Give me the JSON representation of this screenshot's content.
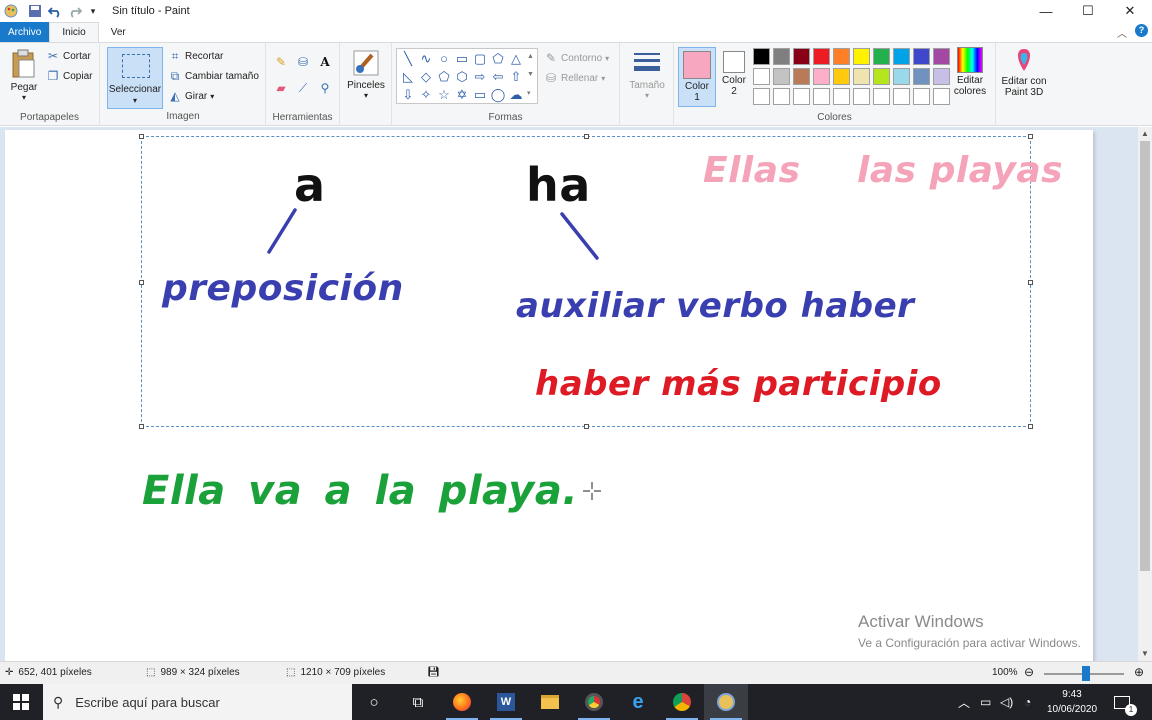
{
  "window": {
    "title": "Sin título - Paint",
    "controls": {
      "minimize": "—",
      "maximize": "☐",
      "close": "✕"
    }
  },
  "menu": {
    "file_tab": "Archivo",
    "tabs": [
      {
        "label": "Inicio",
        "active": true
      },
      {
        "label": "Ver",
        "active": false
      }
    ]
  },
  "ribbon": {
    "clipboard": {
      "paste": "Pegar",
      "cut": "Cortar",
      "copy": "Copiar",
      "group": "Portapapeles"
    },
    "image": {
      "select": "Seleccionar",
      "crop": "Recortar",
      "resize": "Cambiar tamaño",
      "rotate": "Girar",
      "group": "Imagen"
    },
    "tools": {
      "group": "Herramientas"
    },
    "brushes": {
      "label": "Pinceles"
    },
    "shapes": {
      "outline": "Contorno",
      "fill": "Rellenar",
      "group": "Formas"
    },
    "size": {
      "label": "Tamaño"
    },
    "colors": {
      "color1_line1": "Color",
      "color1_line2": "1",
      "color2_line1": "Color",
      "color2_line2": "2",
      "edit_line1": "Editar",
      "edit_line2": "colores",
      "paint3d_line1": "Editar con",
      "paint3d_line2": "Paint 3D",
      "group": "Colores",
      "color1_value": "#f7a8c0",
      "color2_value": "#ffffff",
      "palette": [
        "#000000",
        "#7f7f7f",
        "#880015",
        "#ed1c24",
        "#ff7f27",
        "#fff200",
        "#22b14c",
        "#00a2e8",
        "#3f48cc",
        "#a349a4",
        "#ffffff",
        "#c3c3c3",
        "#b97a57",
        "#ffaec9",
        "#ffc90e",
        "#efe4b0",
        "#b5e61d",
        "#99d9ea",
        "#7092be",
        "#c8bfe7",
        "#ffffff",
        "#ffffff",
        "#ffffff",
        "#ffffff",
        "#ffffff",
        "#ffffff",
        "#ffffff",
        "#ffffff",
        "#ffffff",
        "#ffffff"
      ]
    }
  },
  "canvas": {
    "text_a": "a",
    "text_ha": "ha",
    "text_preposicion": "preposición",
    "text_auxiliar": "auxiliar verbo haber",
    "text_participio": "haber más participio",
    "text_ellas": "Ellas",
    "text_las_playas": "las playas",
    "text_sentence": "Ella va a la playa."
  },
  "watermark": {
    "title": "Activar Windows",
    "subtitle": "Ve a Configuración para activar Windows."
  },
  "statusbar": {
    "cursor_pos": "652, 401 píxeles",
    "selection_size": "989 × 324 píxeles",
    "image_size": "1210 × 709 píxeles",
    "zoom": "100%"
  },
  "taskbar": {
    "search_placeholder": "Escribe aquí para buscar",
    "time": "9:43",
    "date": "10/06/2020",
    "notification_count": "1"
  }
}
